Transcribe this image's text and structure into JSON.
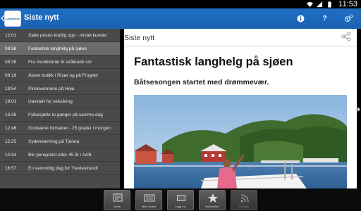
{
  "statusbar": {
    "time": "11:53",
    "icons": [
      "wifi-icon",
      "signal-icon",
      "battery-icon"
    ]
  },
  "appbar": {
    "logo_text": "Lindesnes",
    "title": "Siste nytt",
    "actions": [
      "info-icon",
      "help-icon",
      "settings-icon"
    ],
    "help_glyph": "?"
  },
  "headlines": [
    {
      "time": "12:01",
      "title": "Satte prisen kraftig opp - mistet kunder",
      "selected": false
    },
    {
      "time": "08:58",
      "title": "Fantastisk langhelg på sjøen",
      "selected": true
    },
    {
      "time": "08:39",
      "title": "Fra musikkbråk til strålende sol",
      "selected": false
    },
    {
      "time": "09:19",
      "title": "Åpner butikk i Risør og på Frogner",
      "selected": false
    },
    {
      "time": "19:54",
      "title": "Pinsevennene på Heia",
      "selected": false
    },
    {
      "time": "19:01",
      "title": "Uavklart for seksåring",
      "selected": false
    },
    {
      "time": "13:35",
      "title": "Fylkesjørte to ganger på samme dag",
      "selected": false
    },
    {
      "time": "12:46",
      "title": "Godværet fortsetter - 25 grader i morgen",
      "selected": false
    },
    {
      "time": "12:25",
      "title": "Sydensterning på Tjenna",
      "selected": false
    },
    {
      "time": "10:34",
      "title": "Blir pensjonist etter 45 år i AAB",
      "selected": false
    },
    {
      "time": "16:57",
      "title": "En vannvittig dag for Tvedestrand!",
      "selected": false
    },
    {
      "time": "",
      "title": "",
      "selected": false
    }
  ],
  "article": {
    "section_title": "Siste nytt",
    "headline": "Fantastisk langhelg på sjøen",
    "subheadline": "Båtsesongen startet med drømmevær."
  },
  "toolbar": {
    "buttons": [
      {
        "label": "eAvis",
        "icon": "newspaper-icon",
        "enabled": true
      },
      {
        "label": "Mine avisar",
        "icon": "papers-icon",
        "enabled": true
      },
      {
        "label": "Logg inn",
        "icon": "login-icon",
        "enabled": true
      },
      {
        "label": "Bokmerker",
        "icon": "star-icon",
        "enabled": true
      },
      {
        "label": "Oversikt",
        "icon": "rss-icon",
        "enabled": false
      }
    ]
  },
  "colors": {
    "appbar": "#1f6ec4",
    "sidebar": "#4a4a4a",
    "selected_row": "#6b6b6b"
  }
}
